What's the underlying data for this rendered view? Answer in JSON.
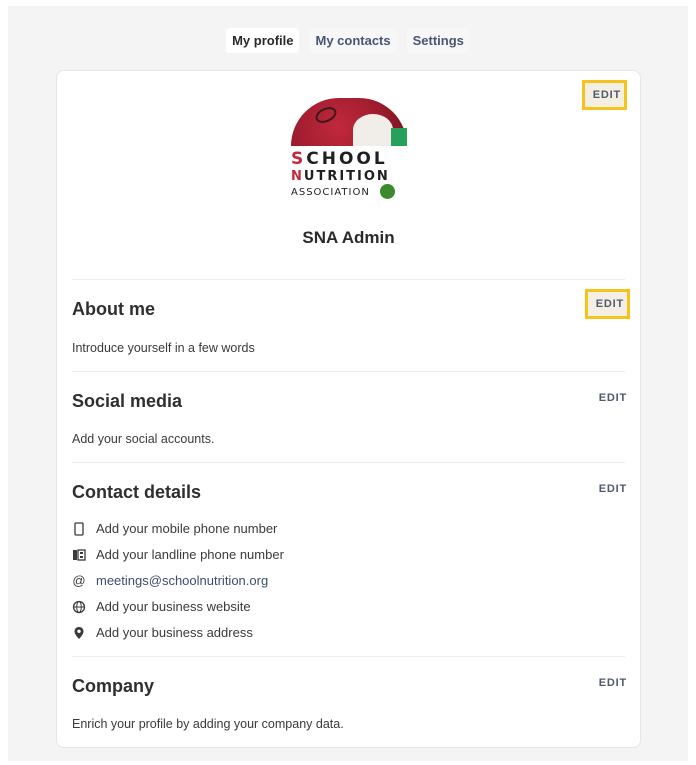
{
  "tabs": [
    {
      "label": "My profile"
    },
    {
      "label": "My contacts"
    },
    {
      "label": "Settings"
    }
  ],
  "profile": {
    "edit_label": "EDIT",
    "name": "SNA Admin",
    "logo": {
      "line1": "SCHOOL",
      "line2": "NUTRITION",
      "line3": "ASSOCIATION"
    }
  },
  "about": {
    "title": "About me",
    "edit_label": "EDIT",
    "description": "Introduce yourself in a few words"
  },
  "social": {
    "title": "Social media",
    "edit_label": "EDIT",
    "description": "Add your social accounts."
  },
  "contact": {
    "title": "Contact details",
    "edit_label": "EDIT",
    "items": [
      {
        "icon": "mobile-phone-icon",
        "text": "Add your mobile phone number"
      },
      {
        "icon": "landline-phone-icon",
        "text": "Add your landline phone number"
      },
      {
        "icon": "at-sign-icon",
        "text": "meetings@schoolnutrition.org"
      },
      {
        "icon": "globe-icon",
        "text": "Add your business website"
      },
      {
        "icon": "location-pin-icon",
        "text": "Add your business address"
      }
    ]
  },
  "company": {
    "title": "Company",
    "edit_label": "EDIT",
    "description": "Enrich your profile by adding your company data."
  },
  "colors": {
    "highlight": "#f6c21c",
    "link": "#3d4c70",
    "online": "#3c8a2e"
  }
}
